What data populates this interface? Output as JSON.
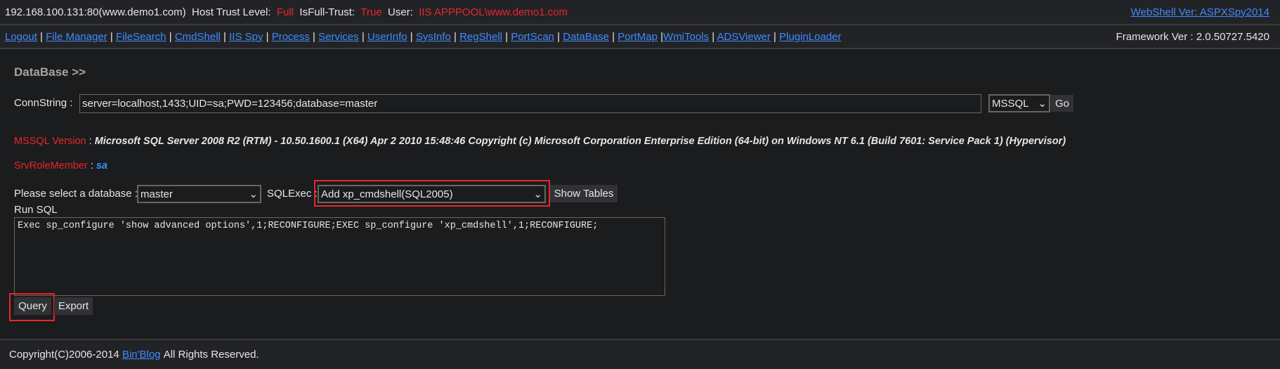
{
  "top": {
    "host": "192.168.100.131:80(www.demo1.com)",
    "trust_label": "Host Trust Level:",
    "trust_value": "Full",
    "fulltrust_label": "IsFull-Trust:",
    "fulltrust_value": "True",
    "user_label": "User:",
    "user_value": "IIS APPPOOL\\www.demo1.com",
    "version_link": "WebShell Ver: ASPXSpy2014"
  },
  "nav": {
    "items": [
      "Logout",
      "File Manager",
      "FileSearch",
      "CmdShell",
      "IIS Spy",
      "Process",
      "Services",
      "UserInfo",
      "SysInfo",
      "RegShell",
      "PortScan",
      "DataBase",
      "PortMap",
      "WmiTools",
      "ADSViewer",
      "PluginLoader"
    ],
    "framework": "Framework Ver : 2.0.50727.5420"
  },
  "main": {
    "title": "DataBase >>",
    "conn_label": "ConnString :",
    "conn_value": "server=localhost,1433;UID=sa;PWD=123456;database=master",
    "db_type": "MSSQL",
    "go": "Go",
    "version_label": "MSSQL Version",
    "version_value": "Microsoft SQL Server 2008 R2 (RTM) - 10.50.1600.1 (X64) Apr 2 2010 15:48:46 Copyright (c) Microsoft Corporation Enterprise Edition (64-bit) on Windows NT 6.1 (Build 7601: Service Pack 1) (Hypervisor)",
    "role_label": "SrvRoleMember",
    "role_value": "sa",
    "colon": ":",
    "select_db_label": "Please select a database :",
    "db_value": "master",
    "sqlexec_label": "SQLExec :",
    "sqlexec_value": "Add xp_cmdshell(SQL2005)",
    "show_tables": "Show Tables",
    "run_sql_label": "Run SQL",
    "sql": "Exec sp_configure 'show advanced options',1;RECONFIGURE;EXEC sp_configure 'xp_cmdshell',1;RECONFIGURE;",
    "query": "Query",
    "export": "Export"
  },
  "footer": {
    "pre": "Copyright(C)2006-2014",
    "link": "Bin'Blog",
    "post": "All Rights Reserved."
  },
  "colors": {
    "accent": "#3d8bff",
    "alert": "#e8262a",
    "highlight_box": "#e8262a"
  }
}
